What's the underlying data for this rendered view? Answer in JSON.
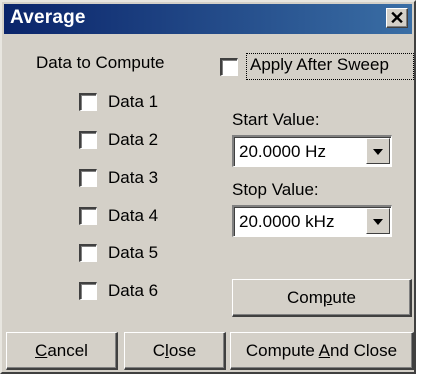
{
  "window": {
    "title": "Average"
  },
  "data_section": {
    "label": "Data to Compute",
    "items": [
      {
        "label": "Data 1",
        "checked": false
      },
      {
        "label": "Data 2",
        "checked": false
      },
      {
        "label": "Data 3",
        "checked": false
      },
      {
        "label": "Data 4",
        "checked": false
      },
      {
        "label": "Data 5",
        "checked": false
      },
      {
        "label": "Data 6",
        "checked": false
      }
    ]
  },
  "apply_after_sweep": {
    "label": "Apply After Sweep",
    "checked": false
  },
  "start": {
    "label": "Start Value:",
    "value": "20.0000  Hz"
  },
  "stop": {
    "label": "Stop Value:",
    "value": "20.0000 kHz"
  },
  "buttons": {
    "compute": {
      "pre": "Com",
      "accel": "p",
      "post": "ute"
    },
    "cancel": {
      "pre": "",
      "accel": "C",
      "post": "ancel"
    },
    "close": {
      "pre": "C",
      "accel": "l",
      "post": "ose"
    },
    "compute_and_close": {
      "pre": "Compute ",
      "accel": "A",
      "post": "nd Close"
    }
  },
  "colors": {
    "titlebar_start": "#0a246a",
    "titlebar_end": "#3a6ea5",
    "face": "#d4d0c8"
  }
}
